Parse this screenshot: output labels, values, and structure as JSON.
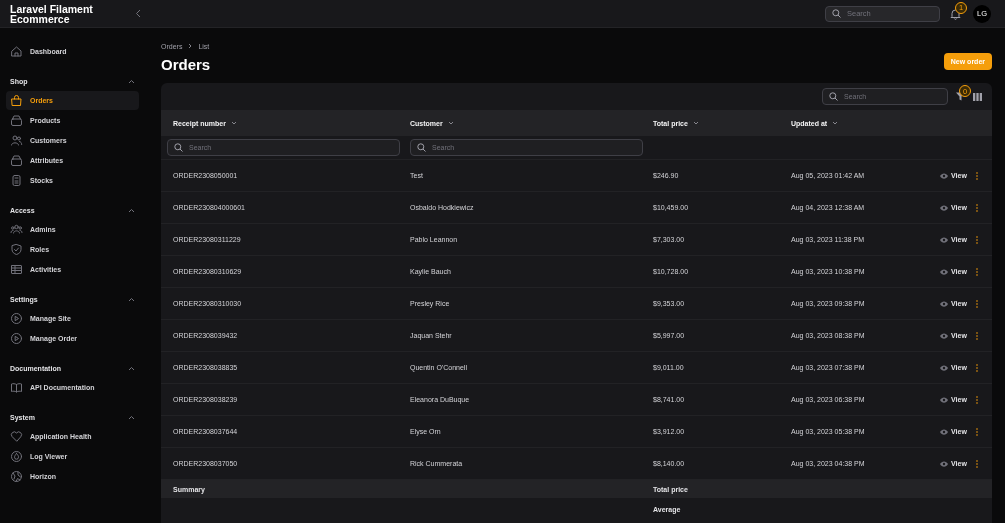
{
  "brand": "Laravel Filament Ecommerce",
  "topbar": {
    "search_placeholder": "Search",
    "notification_count": "1",
    "avatar": "LG"
  },
  "sidebar": {
    "items": [
      {
        "label": "Dashboard",
        "selected": false
      }
    ],
    "groups": [
      {
        "label": "Shop",
        "expanded": true,
        "items": [
          {
            "label": "Orders",
            "selected": true
          },
          {
            "label": "Products",
            "selected": false
          },
          {
            "label": "Customers",
            "selected": false
          },
          {
            "label": "Attributes",
            "selected": false
          },
          {
            "label": "Stocks",
            "selected": false
          }
        ]
      },
      {
        "label": "Access",
        "expanded": true,
        "items": [
          {
            "label": "Admins",
            "selected": false
          },
          {
            "label": "Roles",
            "selected": false
          },
          {
            "label": "Activities",
            "selected": false
          }
        ]
      },
      {
        "label": "Settings",
        "expanded": true,
        "items": [
          {
            "label": "Manage Site",
            "selected": false
          },
          {
            "label": "Manage Order",
            "selected": false
          }
        ]
      },
      {
        "label": "Documentation",
        "expanded": true,
        "items": [
          {
            "label": "API Documentation",
            "selected": false
          }
        ]
      },
      {
        "label": "System",
        "expanded": true,
        "items": [
          {
            "label": "Application Health",
            "selected": false
          },
          {
            "label": "Log Viewer",
            "selected": false
          },
          {
            "label": "Horizon",
            "selected": false
          }
        ]
      }
    ]
  },
  "breadcrumbs": [
    "Orders",
    "List"
  ],
  "title": "Orders",
  "new_button": "New order",
  "table": {
    "search_placeholder": "Search",
    "filter_count": "0",
    "columns": [
      {
        "label": "Receipt number",
        "filter_placeholder": "Search"
      },
      {
        "label": "Customer",
        "filter_placeholder": "Search"
      },
      {
        "label": "Total price"
      },
      {
        "label": "Updated at"
      }
    ],
    "rows": [
      {
        "receipt": "ORDER2308050001",
        "customer": "Test",
        "total": "$246.90",
        "updated": "Aug 05, 2023 01:42 AM",
        "action": "View"
      },
      {
        "receipt": "ORDER230804000601",
        "customer": "Osbaldo Hodkiewicz",
        "total": "$10,459.00",
        "updated": "Aug 04, 2023 12:38 AM",
        "action": "View"
      },
      {
        "receipt": "ORDER23080311229",
        "customer": "Pablo Leannon",
        "total": "$7,303.00",
        "updated": "Aug 03, 2023 11:38 PM",
        "action": "View"
      },
      {
        "receipt": "ORDER23080310629",
        "customer": "Kaylie Bauch",
        "total": "$10,728.00",
        "updated": "Aug 03, 2023 10:38 PM",
        "action": "View"
      },
      {
        "receipt": "ORDER23080310030",
        "customer": "Presley Rice",
        "total": "$9,353.00",
        "updated": "Aug 03, 2023 09:38 PM",
        "action": "View"
      },
      {
        "receipt": "ORDER2308039432",
        "customer": "Jaquan Stehr",
        "total": "$5,997.00",
        "updated": "Aug 03, 2023 08:38 PM",
        "action": "View"
      },
      {
        "receipt": "ORDER2308038835",
        "customer": "Quentin O'Connell",
        "total": "$9,011.00",
        "updated": "Aug 03, 2023 07:38 PM",
        "action": "View"
      },
      {
        "receipt": "ORDER2308038239",
        "customer": "Eleanora DuBuque",
        "total": "$8,741.00",
        "updated": "Aug 03, 2023 06:38 PM",
        "action": "View"
      },
      {
        "receipt": "ORDER2308037644",
        "customer": "Elyse Orn",
        "total": "$3,912.00",
        "updated": "Aug 03, 2023 05:38 PM",
        "action": "View"
      },
      {
        "receipt": "ORDER2308037050",
        "customer": "Rick Cummerata",
        "total": "$8,140.00",
        "updated": "Aug 03, 2023 04:38 PM",
        "action": "View"
      }
    ],
    "summary": {
      "label": "Summary",
      "column_label": "Total price",
      "stat_label": "Average"
    }
  }
}
